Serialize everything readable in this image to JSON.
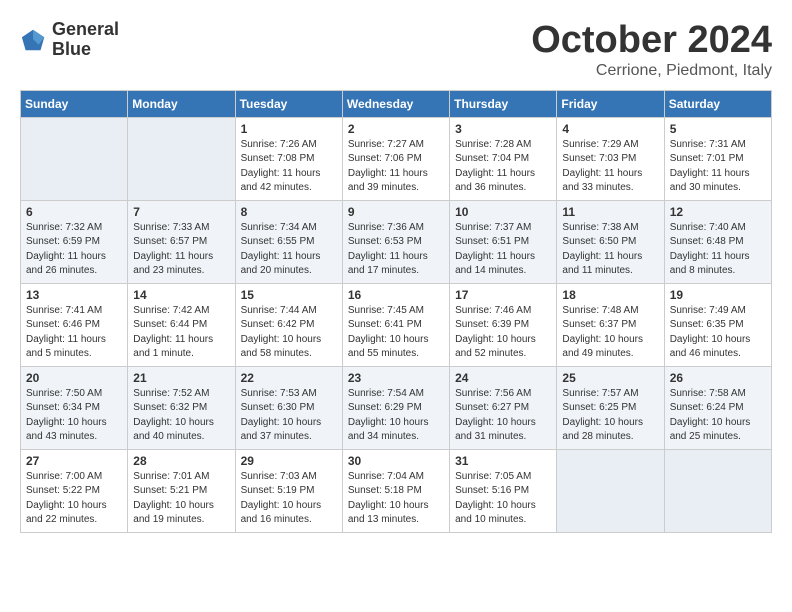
{
  "header": {
    "logo_line1": "General",
    "logo_line2": "Blue",
    "month": "October 2024",
    "location": "Cerrione, Piedmont, Italy"
  },
  "weekdays": [
    "Sunday",
    "Monday",
    "Tuesday",
    "Wednesday",
    "Thursday",
    "Friday",
    "Saturday"
  ],
  "weeks": [
    [
      {
        "day": "",
        "sunrise": "",
        "sunset": "",
        "daylight": ""
      },
      {
        "day": "",
        "sunrise": "",
        "sunset": "",
        "daylight": ""
      },
      {
        "day": "1",
        "sunrise": "Sunrise: 7:26 AM",
        "sunset": "Sunset: 7:08 PM",
        "daylight": "Daylight: 11 hours and 42 minutes."
      },
      {
        "day": "2",
        "sunrise": "Sunrise: 7:27 AM",
        "sunset": "Sunset: 7:06 PM",
        "daylight": "Daylight: 11 hours and 39 minutes."
      },
      {
        "day": "3",
        "sunrise": "Sunrise: 7:28 AM",
        "sunset": "Sunset: 7:04 PM",
        "daylight": "Daylight: 11 hours and 36 minutes."
      },
      {
        "day": "4",
        "sunrise": "Sunrise: 7:29 AM",
        "sunset": "Sunset: 7:03 PM",
        "daylight": "Daylight: 11 hours and 33 minutes."
      },
      {
        "day": "5",
        "sunrise": "Sunrise: 7:31 AM",
        "sunset": "Sunset: 7:01 PM",
        "daylight": "Daylight: 11 hours and 30 minutes."
      }
    ],
    [
      {
        "day": "6",
        "sunrise": "Sunrise: 7:32 AM",
        "sunset": "Sunset: 6:59 PM",
        "daylight": "Daylight: 11 hours and 26 minutes."
      },
      {
        "day": "7",
        "sunrise": "Sunrise: 7:33 AM",
        "sunset": "Sunset: 6:57 PM",
        "daylight": "Daylight: 11 hours and 23 minutes."
      },
      {
        "day": "8",
        "sunrise": "Sunrise: 7:34 AM",
        "sunset": "Sunset: 6:55 PM",
        "daylight": "Daylight: 11 hours and 20 minutes."
      },
      {
        "day": "9",
        "sunrise": "Sunrise: 7:36 AM",
        "sunset": "Sunset: 6:53 PM",
        "daylight": "Daylight: 11 hours and 17 minutes."
      },
      {
        "day": "10",
        "sunrise": "Sunrise: 7:37 AM",
        "sunset": "Sunset: 6:51 PM",
        "daylight": "Daylight: 11 hours and 14 minutes."
      },
      {
        "day": "11",
        "sunrise": "Sunrise: 7:38 AM",
        "sunset": "Sunset: 6:50 PM",
        "daylight": "Daylight: 11 hours and 11 minutes."
      },
      {
        "day": "12",
        "sunrise": "Sunrise: 7:40 AM",
        "sunset": "Sunset: 6:48 PM",
        "daylight": "Daylight: 11 hours and 8 minutes."
      }
    ],
    [
      {
        "day": "13",
        "sunrise": "Sunrise: 7:41 AM",
        "sunset": "Sunset: 6:46 PM",
        "daylight": "Daylight: 11 hours and 5 minutes."
      },
      {
        "day": "14",
        "sunrise": "Sunrise: 7:42 AM",
        "sunset": "Sunset: 6:44 PM",
        "daylight": "Daylight: 11 hours and 1 minute."
      },
      {
        "day": "15",
        "sunrise": "Sunrise: 7:44 AM",
        "sunset": "Sunset: 6:42 PM",
        "daylight": "Daylight: 10 hours and 58 minutes."
      },
      {
        "day": "16",
        "sunrise": "Sunrise: 7:45 AM",
        "sunset": "Sunset: 6:41 PM",
        "daylight": "Daylight: 10 hours and 55 minutes."
      },
      {
        "day": "17",
        "sunrise": "Sunrise: 7:46 AM",
        "sunset": "Sunset: 6:39 PM",
        "daylight": "Daylight: 10 hours and 52 minutes."
      },
      {
        "day": "18",
        "sunrise": "Sunrise: 7:48 AM",
        "sunset": "Sunset: 6:37 PM",
        "daylight": "Daylight: 10 hours and 49 minutes."
      },
      {
        "day": "19",
        "sunrise": "Sunrise: 7:49 AM",
        "sunset": "Sunset: 6:35 PM",
        "daylight": "Daylight: 10 hours and 46 minutes."
      }
    ],
    [
      {
        "day": "20",
        "sunrise": "Sunrise: 7:50 AM",
        "sunset": "Sunset: 6:34 PM",
        "daylight": "Daylight: 10 hours and 43 minutes."
      },
      {
        "day": "21",
        "sunrise": "Sunrise: 7:52 AM",
        "sunset": "Sunset: 6:32 PM",
        "daylight": "Daylight: 10 hours and 40 minutes."
      },
      {
        "day": "22",
        "sunrise": "Sunrise: 7:53 AM",
        "sunset": "Sunset: 6:30 PM",
        "daylight": "Daylight: 10 hours and 37 minutes."
      },
      {
        "day": "23",
        "sunrise": "Sunrise: 7:54 AM",
        "sunset": "Sunset: 6:29 PM",
        "daylight": "Daylight: 10 hours and 34 minutes."
      },
      {
        "day": "24",
        "sunrise": "Sunrise: 7:56 AM",
        "sunset": "Sunset: 6:27 PM",
        "daylight": "Daylight: 10 hours and 31 minutes."
      },
      {
        "day": "25",
        "sunrise": "Sunrise: 7:57 AM",
        "sunset": "Sunset: 6:25 PM",
        "daylight": "Daylight: 10 hours and 28 minutes."
      },
      {
        "day": "26",
        "sunrise": "Sunrise: 7:58 AM",
        "sunset": "Sunset: 6:24 PM",
        "daylight": "Daylight: 10 hours and 25 minutes."
      }
    ],
    [
      {
        "day": "27",
        "sunrise": "Sunrise: 7:00 AM",
        "sunset": "Sunset: 5:22 PM",
        "daylight": "Daylight: 10 hours and 22 minutes."
      },
      {
        "day": "28",
        "sunrise": "Sunrise: 7:01 AM",
        "sunset": "Sunset: 5:21 PM",
        "daylight": "Daylight: 10 hours and 19 minutes."
      },
      {
        "day": "29",
        "sunrise": "Sunrise: 7:03 AM",
        "sunset": "Sunset: 5:19 PM",
        "daylight": "Daylight: 10 hours and 16 minutes."
      },
      {
        "day": "30",
        "sunrise": "Sunrise: 7:04 AM",
        "sunset": "Sunset: 5:18 PM",
        "daylight": "Daylight: 10 hours and 13 minutes."
      },
      {
        "day": "31",
        "sunrise": "Sunrise: 7:05 AM",
        "sunset": "Sunset: 5:16 PM",
        "daylight": "Daylight: 10 hours and 10 minutes."
      },
      {
        "day": "",
        "sunrise": "",
        "sunset": "",
        "daylight": ""
      },
      {
        "day": "",
        "sunrise": "",
        "sunset": "",
        "daylight": ""
      }
    ]
  ]
}
